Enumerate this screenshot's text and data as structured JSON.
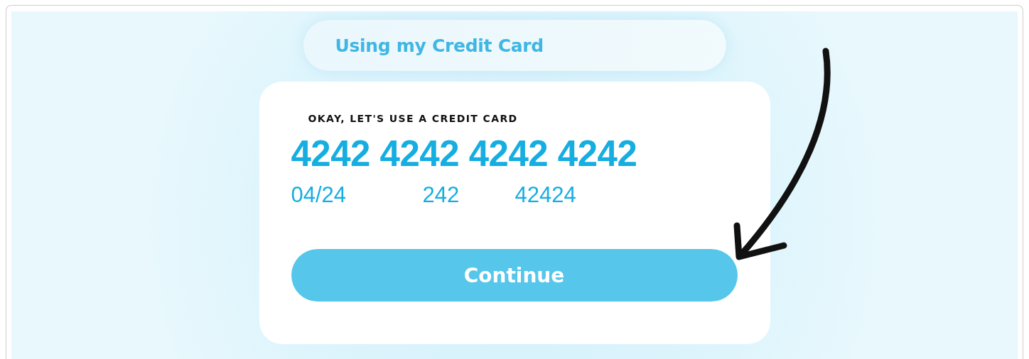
{
  "payment_method_pill": {
    "label": "Using my Credit Card"
  },
  "card_form": {
    "heading": "OKAY, LET'S USE A CREDIT CARD",
    "card_number": "4242 4242 4242 4242",
    "details": [
      {
        "kind": "expiry",
        "text": "04/24"
      },
      {
        "kind": "cvc",
        "text": "242"
      },
      {
        "kind": "zip",
        "text": "42424"
      }
    ],
    "button": {
      "label": "Continue"
    }
  }
}
